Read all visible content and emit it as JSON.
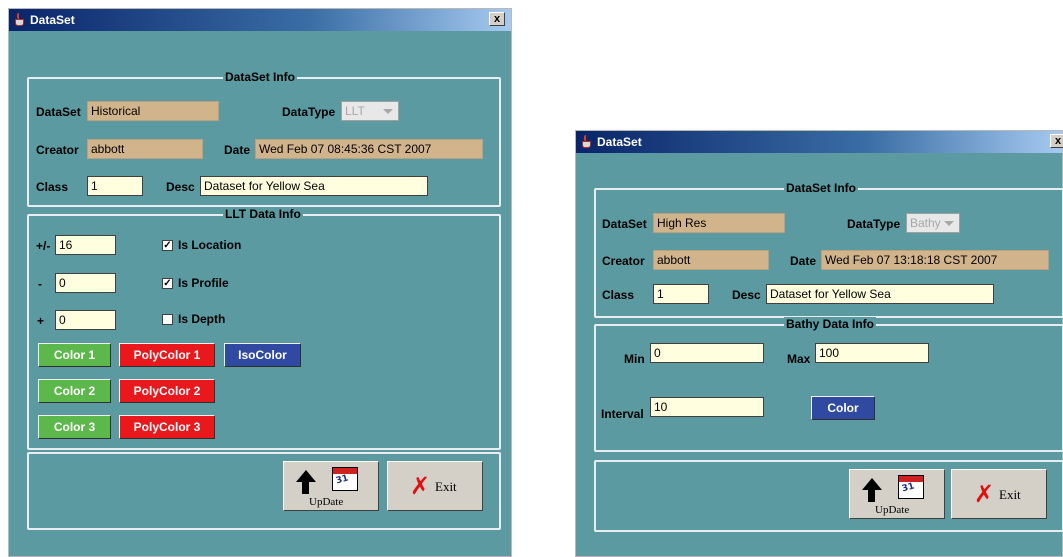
{
  "window1": {
    "title": "DataSet",
    "close_label": "x",
    "dataset_info": {
      "title": "DataSet Info",
      "dataset_label": "DataSet",
      "dataset_value": "Historical",
      "datatype_label": "DataType",
      "datatype_value": "LLT",
      "creator_label": "Creator",
      "creator_value": "abbott",
      "date_label": "Date",
      "date_value": "Wed Feb 07 08:45:36 CST 2007",
      "class_label": "Class",
      "class_value": "1",
      "desc_label": "Desc",
      "desc_value": "Dataset for Yellow Sea"
    },
    "llt_info": {
      "title": "LLT Data Info",
      "pm_label": "+/-",
      "pm_value": "16",
      "minus_label": "-",
      "minus_value": "0",
      "plus_label": "+",
      "plus_value": "0",
      "is_location": "Is Location",
      "is_location_checked": true,
      "is_profile": "Is Profile",
      "is_profile_checked": true,
      "is_depth": "Is Depth",
      "is_depth_checked": false,
      "color1": "Color 1",
      "polycolor1": "PolyColor 1",
      "isocolor": "IsoColor",
      "color2": "Color 2",
      "polycolor2": "PolyColor 2",
      "color3": "Color 3",
      "polycolor3": "PolyColor 3"
    },
    "update_label": "UpDate",
    "exit_label": "Exit"
  },
  "window2": {
    "title": "DataSet",
    "close_label": "x",
    "dataset_info": {
      "title": "DataSet Info",
      "dataset_label": "DataSet",
      "dataset_value": "High Res",
      "datatype_label": "DataType",
      "datatype_value": "Bathy",
      "creator_label": "Creator",
      "creator_value": "abbott",
      "date_label": "Date",
      "date_value": "Wed Feb 07 13:18:18 CST 2007",
      "class_label": "Class",
      "class_value": "1",
      "desc_label": "Desc",
      "desc_value": "Dataset for Yellow Sea"
    },
    "bathy_info": {
      "title": "Bathy Data Info",
      "min_label": "Min",
      "min_value": "0",
      "max_label": "Max",
      "max_value": "100",
      "interval_label": "Interval",
      "interval_value": "10",
      "color": "Color"
    },
    "update_label": "UpDate",
    "exit_label": "Exit"
  },
  "colors": {
    "panel": "#5a9aa0",
    "tan_field": "#d2b48c",
    "cream_field": "#ffffe0",
    "green": "#5cb84a",
    "red": "#e8181c",
    "blue": "#2f4aa0"
  },
  "icons": [
    "java-icon",
    "close-icon",
    "update-icon",
    "exit-icon"
  ]
}
